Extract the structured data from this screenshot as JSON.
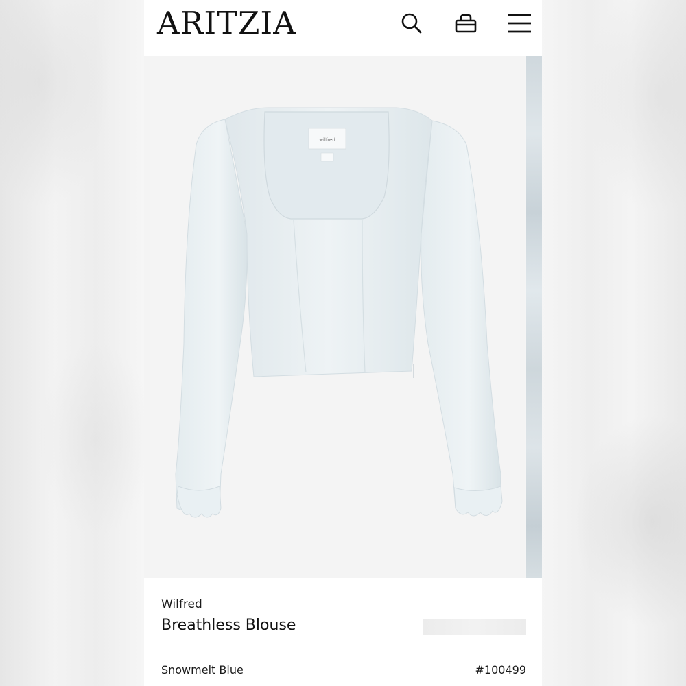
{
  "header": {
    "logo": "ARITZIA",
    "icons": [
      "search-icon",
      "shopping-bag-icon",
      "hamburger-menu-icon"
    ]
  },
  "gallery": {
    "main_image": "product-image-blouse",
    "garment_label_text": "wilfred",
    "garment_color": "#e7eef1"
  },
  "product": {
    "brand": "Wilfred",
    "name": "Breathless Blouse",
    "color": "Snowmelt Blue",
    "style_number": "#100499"
  }
}
